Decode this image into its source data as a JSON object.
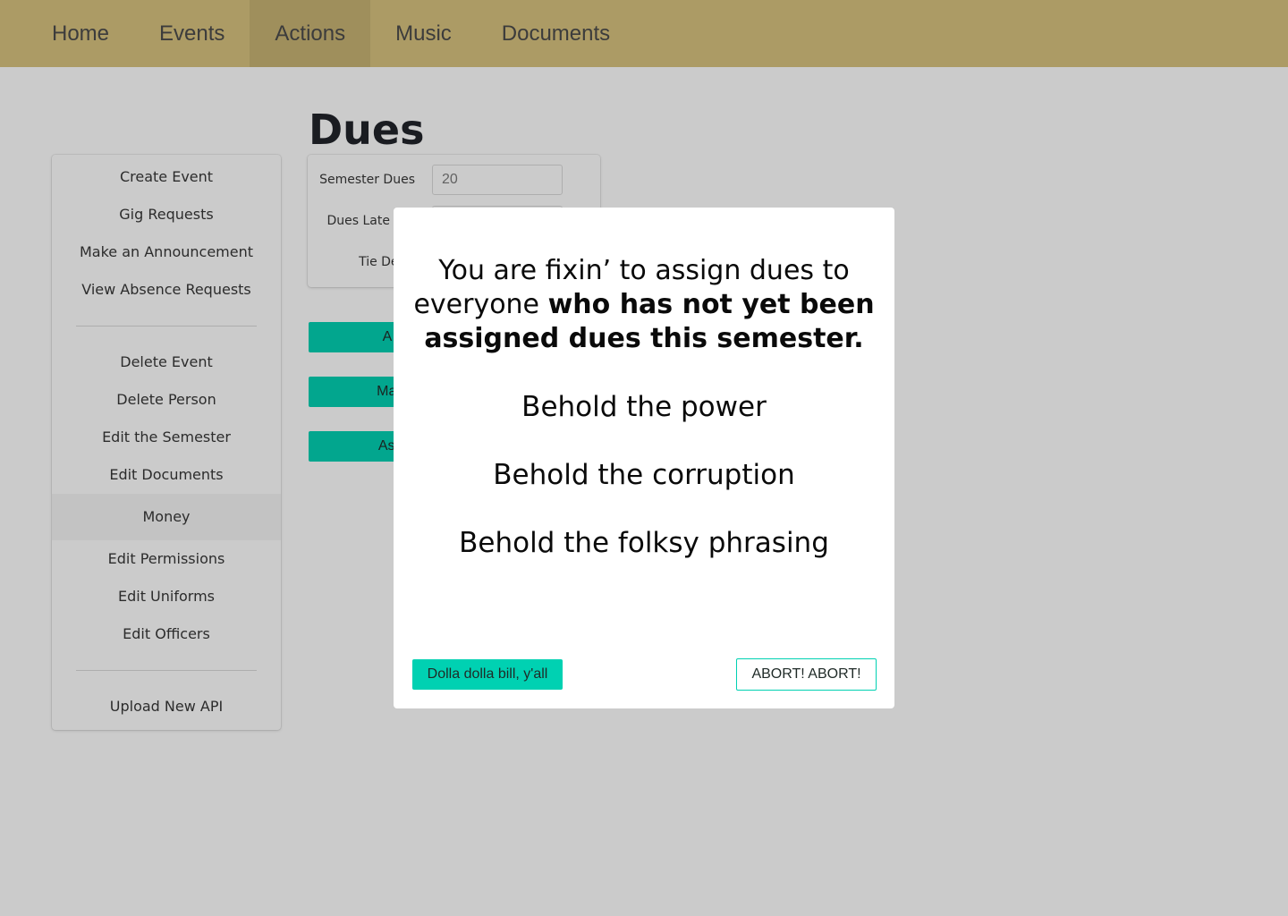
{
  "nav": {
    "items": [
      {
        "label": "Home"
      },
      {
        "label": "Events"
      },
      {
        "label": "Actions"
      },
      {
        "label": "Music"
      },
      {
        "label": "Documents"
      }
    ],
    "active": "Actions"
  },
  "page": {
    "title": "Dues"
  },
  "sidebar": {
    "group1": [
      {
        "label": "Create Event"
      },
      {
        "label": "Gig Requests"
      },
      {
        "label": "Make an Announcement"
      },
      {
        "label": "View Absence Requests"
      }
    ],
    "group2": [
      {
        "label": "Delete Event"
      },
      {
        "label": "Delete Person"
      },
      {
        "label": "Edit the Semester"
      },
      {
        "label": "Edit Documents"
      },
      {
        "label": "Money"
      },
      {
        "label": "Edit Permissions"
      },
      {
        "label": "Edit Uniforms"
      },
      {
        "label": "Edit Officers"
      }
    ],
    "group3": [
      {
        "label": "Upload New API"
      }
    ],
    "active": "Money"
  },
  "dues_form": {
    "semester_dues_label": "Semester Dues",
    "semester_dues_value": "20",
    "dues_late_label": "Dues Late",
    "tie_deposit_label": "Tie Depo"
  },
  "actions": {
    "button1_label": "A",
    "button2_label": "Mal",
    "button3_label": "Assi"
  },
  "modal": {
    "lead_prefix": "You are fixin’ to assign dues to everyone ",
    "lead_bold": "who has not yet been assigned dues this semester.",
    "line1": "Behold the power",
    "line2": "Behold the corruption",
    "line3": "Behold the folksy phrasing",
    "confirm_label": "Dolla dolla bill, y'all",
    "abort_label": "ABORT! ABORT!"
  },
  "colors": {
    "navbar": "#d8c27e",
    "navbar_active": "#c8b373",
    "primary": "#00d1b2",
    "overlay": "rgba(10,10,10,0.21)"
  }
}
